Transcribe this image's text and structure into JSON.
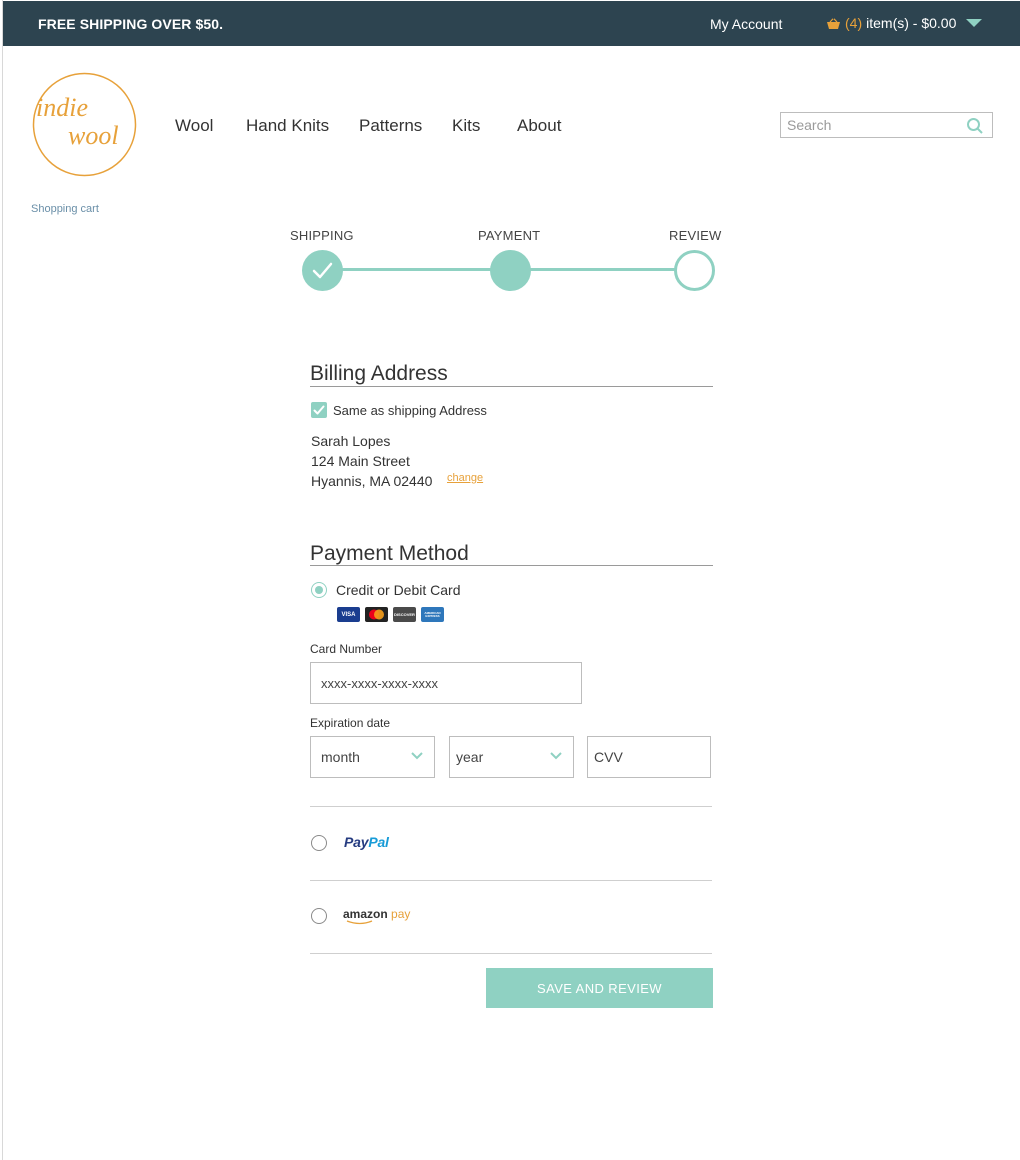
{
  "topbar": {
    "shipping_prefix": "FREE SHIPPING OVER ",
    "shipping_amount": "$50",
    "shipping_suffix": ".",
    "account": "My Account",
    "cart_count": "(4)",
    "cart_text": " item(s) - $0.00"
  },
  "logo": {
    "line1": "indie",
    "line2": "wool"
  },
  "nav": [
    "Wool",
    "Hand Knits",
    "Patterns",
    "Kits",
    "About"
  ],
  "search": {
    "placeholder": "Search"
  },
  "breadcrumb": "Shopping cart",
  "steps": [
    {
      "label": "SHIPPING",
      "state": "complete"
    },
    {
      "label": "PAYMENT",
      "state": "current"
    },
    {
      "label": "REVIEW",
      "state": "upcoming"
    }
  ],
  "billing": {
    "title": "Billing Address",
    "same_as_shipping_label": "Same as shipping Address",
    "same_as_shipping": true,
    "name": "Sarah Lopes",
    "street": "124 Main Street",
    "city": "Hyannis, MA 02440",
    "change": "change"
  },
  "payment": {
    "title": "Payment Method",
    "card_option": "Credit or Debit Card",
    "card_brands": [
      "VISA",
      "MasterCard",
      "DISCOVER",
      "AMERICAN EXPRESS"
    ],
    "card_number_label": "Card Number",
    "card_number_value": "xxxx-xxxx-xxxx-xxxx",
    "expiration_label": "Expiration date",
    "month": "month",
    "year": "year",
    "cvv": "CVV",
    "paypal_1": "Pay",
    "paypal_2": "Pal",
    "amazon_1": "amazon",
    "amazon_2": " pay",
    "selected": "card"
  },
  "submit": "SAVE  AND REVIEW",
  "colors": {
    "teal": "#8fd1c2",
    "navy": "#2d4450",
    "orange": "#e7a13a"
  }
}
